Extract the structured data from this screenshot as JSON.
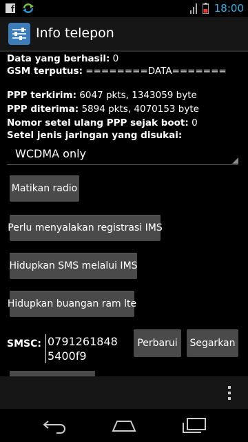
{
  "status_bar": {
    "time": "18:00",
    "icons": [
      "facebook-icon",
      "sync-icon",
      "signal-icon",
      "battery-icon"
    ],
    "time_color": "#33b5e5"
  },
  "action_bar": {
    "title": "Info telepon",
    "icon": "settings-sliders-icon"
  },
  "info": {
    "data_success_label": "Data yang berhasil:",
    "data_success_value": "0",
    "gsm_disconnect_label": "GSM terputus:",
    "gsm_disconnect_value": "========DATA=======",
    "ppp_sent_label": "PPP terkirim:",
    "ppp_sent_value": "6047 pkts, 1343059 byte",
    "ppp_received_label": "PPP diterima:",
    "ppp_received_value": "5894 pkts, 4070153 byte",
    "ppp_reset_label": "Nomor setel ulang PPP sejak boot:",
    "ppp_reset_value": "0",
    "network_type_label": "Setel jenis jaringan yang disukai:"
  },
  "network_spinner": {
    "selected": "WCDMA only"
  },
  "buttons": {
    "radio_off": "Matikan radio",
    "ims_required": "Perlu menyalakan registrasi IMS",
    "sms_over_ims": "Hidupkan SMS melalui IMS",
    "lte_ram_dump": "Hidupkan buangan ram lte"
  },
  "smsc": {
    "label": "SMSC:",
    "value_line1": "0791261848",
    "value_line2": "5400f9",
    "update_button": "Perbarui",
    "refresh_button": "Segarkan"
  },
  "navigation": {
    "icons": [
      "back-icon",
      "home-icon",
      "recent-apps-icon",
      "overflow-menu-icon"
    ]
  }
}
